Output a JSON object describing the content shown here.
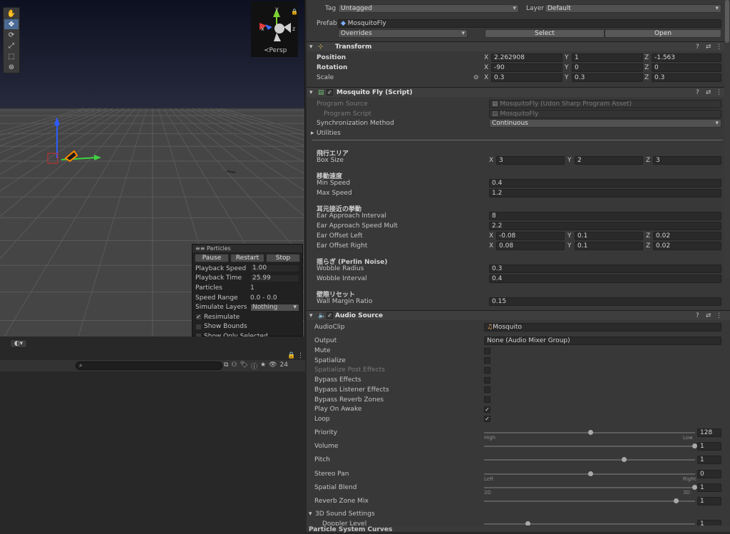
{
  "scene": {
    "persp_label": "≺Persp",
    "gizmo_y": "y",
    "gizmo_x": "x",
    "gizmo_z": "z"
  },
  "particles": {
    "title": "Particles",
    "buttons": [
      "Pause",
      "Restart",
      "Stop"
    ],
    "rows": [
      {
        "label": "Playback Speed",
        "value": "1.00",
        "field": true
      },
      {
        "label": "Playback Time",
        "value": "25.99",
        "field": true
      },
      {
        "label": "Particles",
        "value": "1",
        "field": false
      },
      {
        "label": "Speed Range",
        "value": "0.0 - 0.0",
        "field": false
      }
    ],
    "simulate_label": "Simulate Layers",
    "simulate_value": "Nothing",
    "checks": [
      {
        "label": "Resimulate",
        "checked": true
      },
      {
        "label": "Show Bounds",
        "checked": false
      },
      {
        "label": "Show Only Selected",
        "checked": false
      }
    ]
  },
  "hierarchy": {
    "count": "24"
  },
  "inspector": {
    "tag_label": "Tag",
    "tag_value": "Untagged",
    "layer_label": "Layer",
    "layer_value": "Default",
    "prefab_label": "Prefab",
    "prefab_value": "MosquitoFly",
    "overrides_label": "Overrides",
    "select_label": "Select",
    "open_label": "Open",
    "transform": {
      "title": "Transform",
      "position_label": "Position",
      "pos": [
        "2.262908",
        "1",
        "-1.563"
      ],
      "rotation_label": "Rotation",
      "rot": [
        "-90",
        "0",
        "0"
      ],
      "scale_label": "Scale",
      "scale": [
        "0.3",
        "0.3",
        "0.3"
      ]
    },
    "script": {
      "title": "Mosquito Fly (Script)",
      "program_source_label": "Program Source",
      "program_source_value": "MosquitoFly (Udon Sharp Program Asset)",
      "program_script_label": "Program Script",
      "program_script_value": "MosquitoFly",
      "sync_label": "Synchronization Method",
      "sync_value": "Continuous",
      "utilities_label": "Utilities",
      "sec_area": "飛行エリア",
      "box_size_label": "Box Size",
      "box_size": [
        "3",
        "2",
        "3"
      ],
      "sec_speed": "移動速度",
      "min_speed_label": "Min Speed",
      "min_speed": "0.4",
      "max_speed_label": "Max Speed",
      "max_speed": "1.2",
      "sec_ear": "耳元接近の挙動",
      "ear_interval_label": "Ear Approach Interval",
      "ear_interval": "8",
      "ear_mult_label": "Ear Approach Speed Mult",
      "ear_mult": "2.2",
      "ear_left_label": "Ear Offset Left",
      "ear_left": [
        "-0.08",
        "0.1",
        "0.02"
      ],
      "ear_right_label": "Ear Offset Right",
      "ear_right": [
        "0.08",
        "0.1",
        "0.02"
      ],
      "sec_wobble": "揺らぎ (Perlin Noise)",
      "wobble_radius_label": "Wobble Radius",
      "wobble_radius": "0.3",
      "wobble_interval_label": "Wobble Interval",
      "wobble_interval": "0.4",
      "sec_wall": "壁際リセット",
      "wall_margin_label": "Wall Margin Ratio",
      "wall_margin": "0.15"
    },
    "audio": {
      "title": "Audio Source",
      "clip_label": "AudioClip",
      "clip_value": "Mosquito",
      "output_label": "Output",
      "output_value": "None (Audio Mixer Group)",
      "toggles": [
        {
          "label": "Mute",
          "checked": false,
          "dim": false
        },
        {
          "label": "Spatialize",
          "checked": false,
          "dim": false
        },
        {
          "label": "Spatialize Post Effects",
          "checked": false,
          "dim": true
        },
        {
          "label": "Bypass Effects",
          "checked": false,
          "dim": false
        },
        {
          "label": "Bypass Listener Effects",
          "checked": false,
          "dim": false
        },
        {
          "label": "Bypass Reverb Zones",
          "checked": false,
          "dim": false
        },
        {
          "label": "Play On Awake",
          "checked": true,
          "dim": false
        },
        {
          "label": "Loop",
          "checked": true,
          "dim": false
        }
      ],
      "sliders": [
        {
          "label": "Priority",
          "value": "128",
          "frac": 0.5,
          "left": "High",
          "right": "Low"
        },
        {
          "label": "Volume",
          "value": "1",
          "frac": 1.0,
          "left": "",
          "right": ""
        },
        {
          "label": "Pitch",
          "value": "1",
          "frac": 0.66,
          "left": "",
          "right": ""
        },
        {
          "label": "Stereo Pan",
          "value": "0",
          "frac": 0.5,
          "left": "Left",
          "right": "Right"
        },
        {
          "label": "Spatial Blend",
          "value": "1",
          "frac": 1.0,
          "left": "2D",
          "right": "3D"
        },
        {
          "label": "Reverb Zone Mix",
          "value": "1",
          "frac": 0.91,
          "left": "",
          "right": ""
        }
      ],
      "sound3d_label": "3D Sound Settings",
      "doppler_label": "Doppler Level",
      "doppler_value": "1"
    },
    "bottom_tab": "Particle System Curves"
  }
}
